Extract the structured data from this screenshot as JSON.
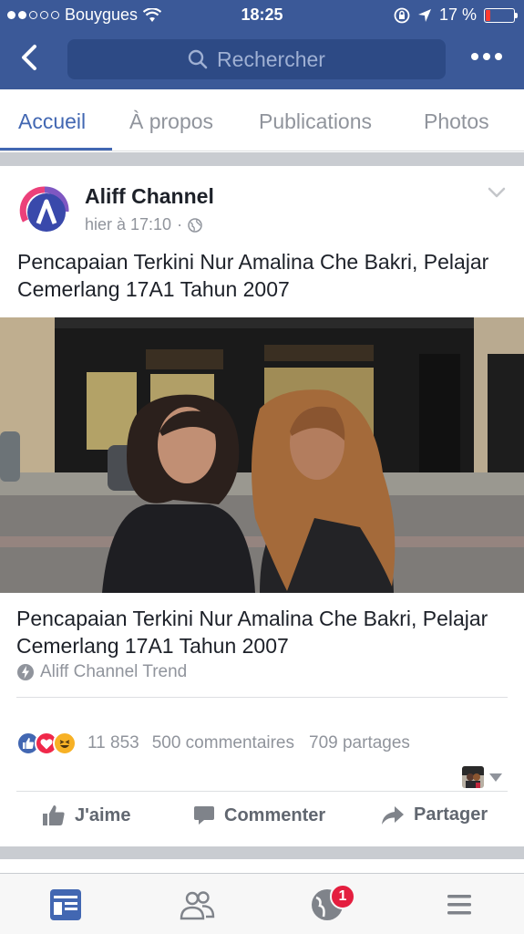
{
  "status": {
    "carrier": "Bouygues",
    "time": "18:25",
    "battery": "17 %",
    "battery_level": 0.17
  },
  "nav": {
    "search_placeholder": "Rechercher"
  },
  "tabs": [
    {
      "label": "Accueil",
      "active": true
    },
    {
      "label": "À propos",
      "active": false
    },
    {
      "label": "Publications",
      "active": false
    },
    {
      "label": "Photos",
      "active": false
    }
  ],
  "post": {
    "author": "Aliff Channel",
    "time": "hier à 17:10",
    "text": "Pencapaian Terkini Nur Amalina Che Bakri, Pelajar Cemerlang 17A1 Tahun 2007",
    "link_title": "Pencapaian Terkini Nur Amalina Che Bakri, Pelajar Cemerlang 17A1 Tahun 2007",
    "link_source": "Aliff Channel Trend",
    "reactions_count": "11 853",
    "comments": "500 commentaires",
    "shares": "709 partages",
    "actions": {
      "like": "J'aime",
      "comment": "Commenter",
      "share": "Partager"
    }
  },
  "bottom_nav": {
    "notifications_badge": "1"
  },
  "colors": {
    "brand": "#3b5998",
    "accent": "#4267b2",
    "badge": "#e41e3f"
  }
}
